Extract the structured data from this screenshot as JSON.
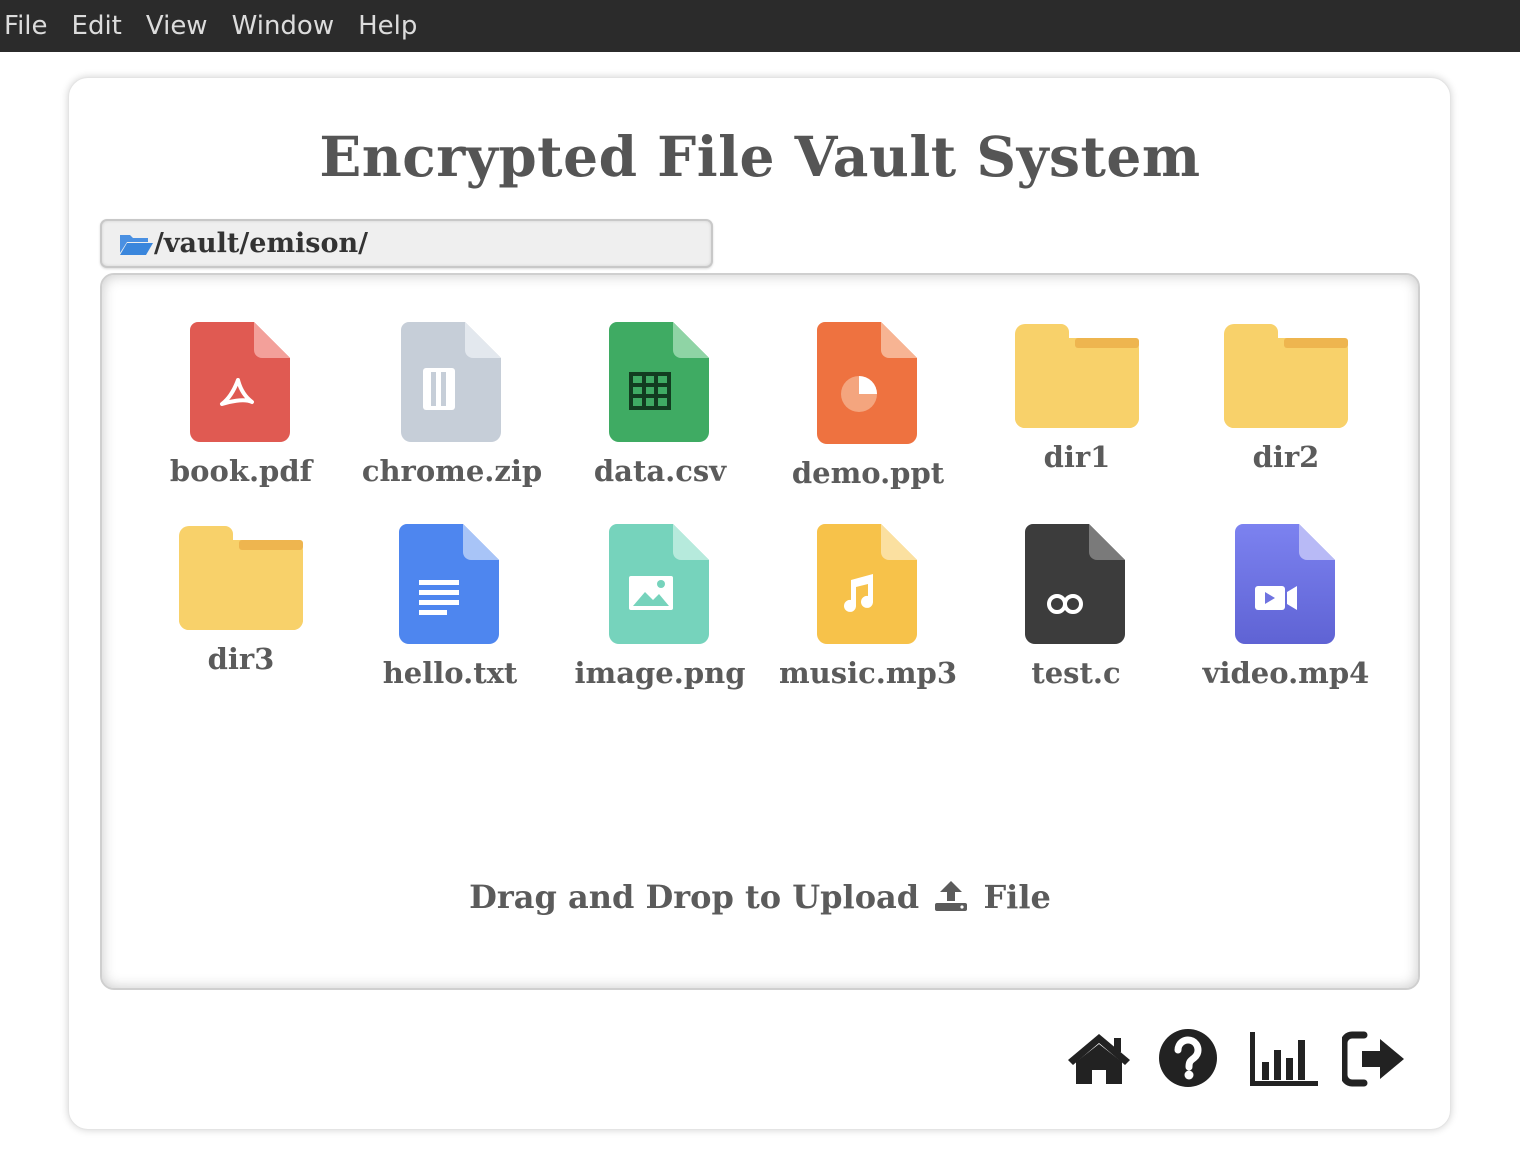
{
  "menubar": {
    "items": [
      "File",
      "Edit",
      "View",
      "Window",
      "Help"
    ]
  },
  "title": "Encrypted File Vault System",
  "path": "/vault/emison/",
  "files": [
    {
      "name": "book.pdf",
      "icon": "pdf-file-icon"
    },
    {
      "name": "chrome.zip",
      "icon": "zip-file-icon"
    },
    {
      "name": "data.csv",
      "icon": "spreadsheet-file-icon"
    },
    {
      "name": "demo.ppt",
      "icon": "presentation-file-icon"
    },
    {
      "name": "dir1",
      "icon": "folder-icon"
    },
    {
      "name": "dir2",
      "icon": "folder-icon"
    },
    {
      "name": "dir3",
      "icon": "folder-icon"
    },
    {
      "name": "hello.txt",
      "icon": "text-file-icon"
    },
    {
      "name": "image.png",
      "icon": "image-file-icon"
    },
    {
      "name": "music.mp3",
      "icon": "audio-file-icon"
    },
    {
      "name": "test.c",
      "icon": "code-file-icon"
    },
    {
      "name": "video.mp4",
      "icon": "video-file-icon"
    }
  ],
  "upload": {
    "before": "Drag and Drop to Upload",
    "after": "File",
    "icon": "upload-icon"
  },
  "nav": [
    {
      "name": "home",
      "icon": "home-icon"
    },
    {
      "name": "help",
      "icon": "question-circle-icon"
    },
    {
      "name": "stats",
      "icon": "bar-chart-icon"
    },
    {
      "name": "logout",
      "icon": "sign-out-icon"
    }
  ],
  "colors": {
    "menubar_bg": "#2b2b2b",
    "pdf": "#e05a52",
    "zip": "#c6ced8",
    "csv": "#3fab63",
    "ppt": "#ee7240",
    "folder": "#f8d16a",
    "txt": "#4e86ef",
    "png": "#76d3bc",
    "mp3": "#f7c24a",
    "code": "#3c3c3c",
    "video": "#6f73e0"
  }
}
